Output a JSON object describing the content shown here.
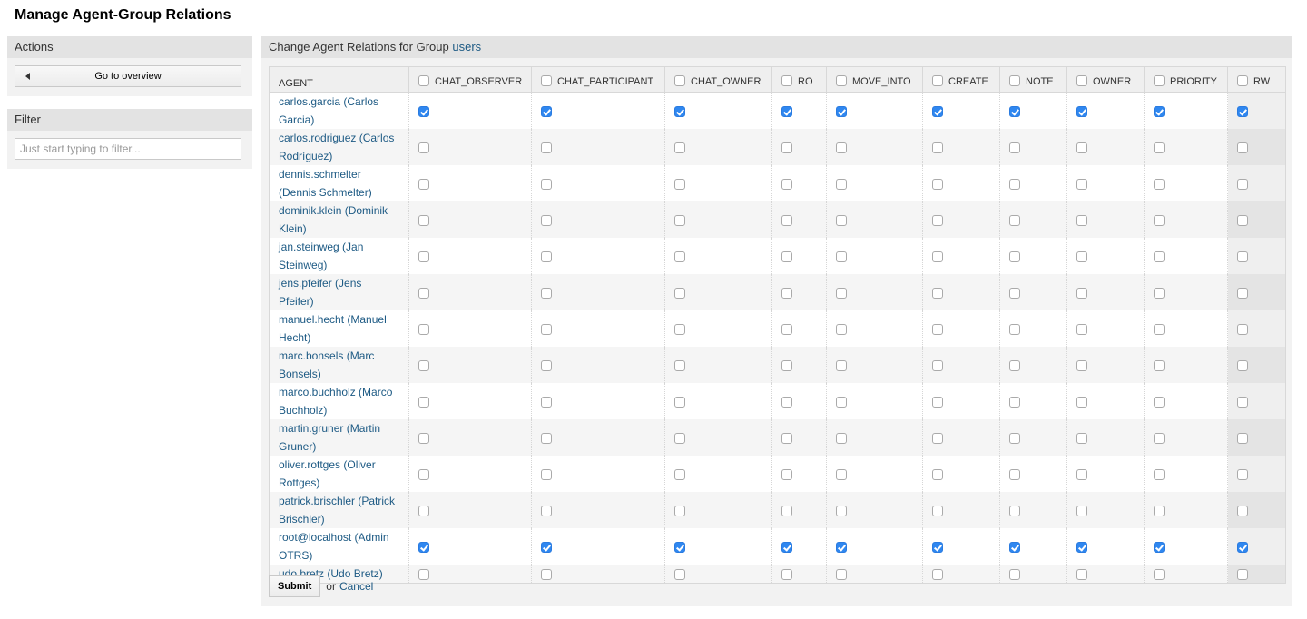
{
  "page_title": "Manage Agent-Group Relations",
  "sidebar": {
    "actions": {
      "title": "Actions",
      "go_to_overview_label": "Go to overview"
    },
    "filter": {
      "title": "Filter",
      "placeholder": "Just start typing to filter...",
      "value": ""
    }
  },
  "main": {
    "header_prefix": "Change Agent Relations for Group ",
    "group_name": "users",
    "table": {
      "agent_column": "AGENT",
      "permission_columns": [
        {
          "label": "CHAT_OBSERVER",
          "checked": false
        },
        {
          "label": "CHAT_PARTICIPANT",
          "checked": false
        },
        {
          "label": "CHAT_OWNER",
          "checked": false
        },
        {
          "label": "RO",
          "checked": false
        },
        {
          "label": "MOVE_INTO",
          "checked": false
        },
        {
          "label": "CREATE",
          "checked": false
        },
        {
          "label": "NOTE",
          "checked": false
        },
        {
          "label": "OWNER",
          "checked": false
        },
        {
          "label": "PRIORITY",
          "checked": false
        },
        {
          "label": "RW",
          "checked": false
        }
      ],
      "rows": [
        {
          "agent": "carlos.garcia (Carlos Garcia)",
          "two_line": true,
          "permissions": [
            true,
            true,
            true,
            true,
            true,
            true,
            true,
            true,
            true,
            true
          ]
        },
        {
          "agent": "carlos.rodriguez (Carlos Rodríguez)",
          "two_line": true,
          "permissions": [
            false,
            false,
            false,
            false,
            false,
            false,
            false,
            false,
            false,
            false
          ]
        },
        {
          "agent": "dennis.schmelter (Dennis Schmelter)",
          "two_line": true,
          "permissions": [
            false,
            false,
            false,
            false,
            false,
            false,
            false,
            false,
            false,
            false
          ]
        },
        {
          "agent": "dominik.klein (Dominik Klein)",
          "two_line": true,
          "permissions": [
            false,
            false,
            false,
            false,
            false,
            false,
            false,
            false,
            false,
            false
          ]
        },
        {
          "agent": "jan.steinweg (Jan Steinweg)",
          "two_line": true,
          "permissions": [
            false,
            false,
            false,
            false,
            false,
            false,
            false,
            false,
            false,
            false
          ]
        },
        {
          "agent": "jens.pfeifer (Jens Pfeifer)",
          "two_line": false,
          "permissions": [
            false,
            false,
            false,
            false,
            false,
            false,
            false,
            false,
            false,
            false
          ]
        },
        {
          "agent": "manuel.hecht (Manuel Hecht)",
          "two_line": true,
          "permissions": [
            false,
            false,
            false,
            false,
            false,
            false,
            false,
            false,
            false,
            false
          ]
        },
        {
          "agent": "marc.bonsels (Marc Bonsels)",
          "two_line": true,
          "permissions": [
            false,
            false,
            false,
            false,
            false,
            false,
            false,
            false,
            false,
            false
          ]
        },
        {
          "agent": "marco.buchholz (Marco Buchholz)",
          "two_line": true,
          "permissions": [
            false,
            false,
            false,
            false,
            false,
            false,
            false,
            false,
            false,
            false
          ]
        },
        {
          "agent": "martin.gruner (Martin Gruner)",
          "two_line": true,
          "permissions": [
            false,
            false,
            false,
            false,
            false,
            false,
            false,
            false,
            false,
            false
          ]
        },
        {
          "agent": "oliver.rottges (Oliver Rottges)",
          "two_line": true,
          "permissions": [
            false,
            false,
            false,
            false,
            false,
            false,
            false,
            false,
            false,
            false
          ]
        },
        {
          "agent": "patrick.brischler (Patrick Brischler)",
          "two_line": true,
          "permissions": [
            false,
            false,
            false,
            false,
            false,
            false,
            false,
            false,
            false,
            false
          ]
        },
        {
          "agent": "root@localhost (Admin OTRS)",
          "two_line": true,
          "permissions": [
            true,
            true,
            true,
            true,
            true,
            true,
            true,
            true,
            true,
            true
          ]
        },
        {
          "agent": "udo.bretz (Udo Bretz)",
          "two_line": false,
          "permissions": [
            false,
            false,
            false,
            false,
            false,
            false,
            false,
            false,
            false,
            false
          ]
        }
      ]
    },
    "submit_label": "Submit",
    "or_text": "or",
    "cancel_label": "Cancel"
  },
  "colors": {
    "link": "#1d5a84",
    "checkbox_checked": "#2f87f0"
  }
}
